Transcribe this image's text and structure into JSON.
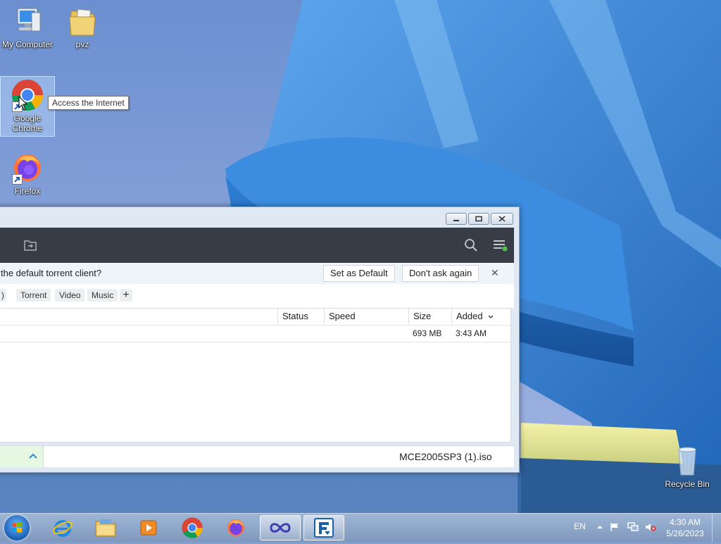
{
  "desktop": {
    "icons": {
      "my_computer": "My Computer",
      "pvz": "pvz",
      "chrome": "Google Chrome",
      "firefox": "Firefox",
      "recycle_bin": "Recycle Bin"
    },
    "tooltip": "Access the Internet"
  },
  "app": {
    "notice": {
      "text": "the default torrent client?",
      "set_default": "Set as Default",
      "dont_ask": "Don't ask again",
      "close": "✕"
    },
    "filters": [
      ")",
      "Torrent",
      "Video",
      "Music",
      "+"
    ],
    "columns": [
      "Status",
      "Speed",
      "Size",
      "Added"
    ],
    "rows": [
      {
        "status": "",
        "speed": "",
        "size": "693 MB",
        "added": "3:43 AM"
      }
    ],
    "status_file": "MCE2005SP3 (1).iso"
  },
  "taskbar": {
    "language": "EN",
    "time": "4:30 AM",
    "date": "5/26/2023"
  },
  "colors": {
    "toolbar": "#383c47",
    "status_accent": "#e6f7e2",
    "taskbar": "#8aa5cc"
  }
}
